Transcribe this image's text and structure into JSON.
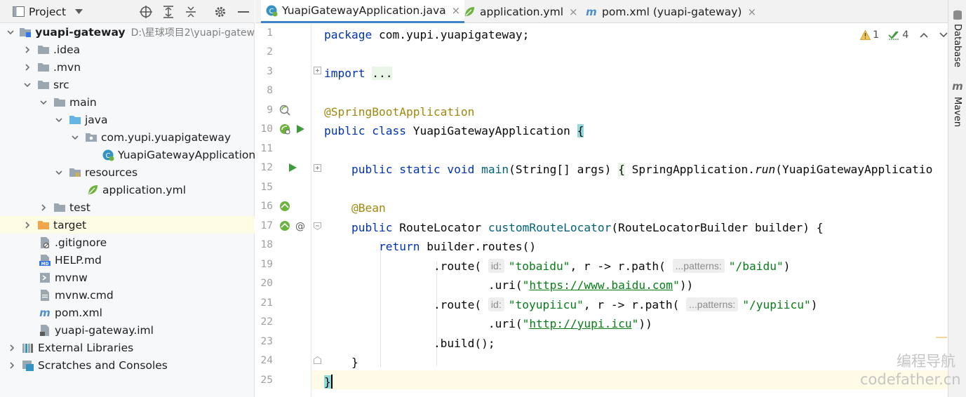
{
  "project_panel": {
    "title": "Project",
    "tree": [
      {
        "label": "yuapi-gateway",
        "path": "D:\\星球项目2\\yuapi-gatew",
        "icon": "module-folder-icon"
      },
      {
        "label": ".idea",
        "icon": "folder-icon"
      },
      {
        "label": ".mvn",
        "icon": "folder-icon"
      },
      {
        "label": "src",
        "icon": "folder-icon"
      },
      {
        "label": "main",
        "icon": "folder-icon"
      },
      {
        "label": "java",
        "icon": "source-folder-icon"
      },
      {
        "label": "com.yupi.yuapigateway",
        "icon": "package-icon"
      },
      {
        "label": "YuapiGatewayApplication",
        "icon": "spring-boot-class-icon"
      },
      {
        "label": "resources",
        "icon": "resources-folder-icon"
      },
      {
        "label": "application.yml",
        "icon": "spring-yml-icon"
      },
      {
        "label": "test",
        "icon": "folder-icon"
      },
      {
        "label": "target",
        "icon": "excluded-folder-icon"
      },
      {
        "label": ".gitignore",
        "icon": "ignore-file-icon"
      },
      {
        "label": "HELP.md",
        "icon": "markdown-icon"
      },
      {
        "label": "mvnw",
        "icon": "shell-file-icon"
      },
      {
        "label": "mvnw.cmd",
        "icon": "file-icon"
      },
      {
        "label": "pom.xml",
        "icon": "maven-icon"
      },
      {
        "label": "yuapi-gateway.iml",
        "icon": "iml-file-icon"
      },
      {
        "label": "External Libraries",
        "icon": "libraries-icon"
      },
      {
        "label": "Scratches and Consoles",
        "icon": "scratches-icon"
      }
    ]
  },
  "tabs": [
    {
      "label": "YuapiGatewayApplication.java",
      "close": "×"
    },
    {
      "label": "application.yml",
      "close": "×"
    },
    {
      "label": "pom.xml (yuapi-gateway)",
      "close": "×"
    }
  ],
  "inspections": {
    "warnings": "1",
    "weak_warnings": "4"
  },
  "line_numbers": [
    "1",
    "2",
    "3",
    "8",
    "9",
    "10",
    "11",
    "12",
    "15",
    "16",
    "17",
    "18",
    "19",
    "20",
    "21",
    "22",
    "23",
    "24",
    "25"
  ],
  "code": {
    "l1_kw": "package",
    "l1_rest": " com.yupi.yuapigateway;",
    "l3_kw": "import",
    "l3_fold": "...",
    "l9_ann": "@SpringBootApplication",
    "l10_kw": "public class",
    "l10_name": " YuapiGatewayApplication ",
    "l10_brace": "{",
    "l12_kw": "public static void",
    "l12_fn": "main",
    "l12_args": "(String[] args) ",
    "l12_brace": "{",
    "l12_call": " SpringApplication.",
    "l12_run": "run",
    "l12_tail": "(YuapiGatewayApplicatio",
    "l16_ann": "@Bean",
    "l17_kw": "public",
    "l17_type": " RouteLocator ",
    "l17_fn": "customRouteLocator",
    "l17_rest": "(RouteLocatorBuilder builder) {",
    "l18_kw": "return",
    "l18_rest": " builder.routes()",
    "l19_a": ".route(",
    "l19_hint_id": "id:",
    "l19_str": "\"tobaidu\"",
    "l19_b": ", r -> r.path(",
    "l19_hint_pat": "...patterns:",
    "l19_path": "\"/baidu\"",
    "l19_c": ")",
    "l20_a": ".uri(",
    "l20_q1": "\"",
    "l20_url": "https://www.baidu.com",
    "l20_q2": "\"",
    "l20_c": "))",
    "l21_a": ".route(",
    "l21_hint_id": "id:",
    "l21_str": "\"toyupiicu\"",
    "l21_b": ", r -> r.path(",
    "l21_hint_pat": "...patterns:",
    "l21_path": "\"/yupiicu\"",
    "l21_c": ")",
    "l22_a": ".uri(",
    "l22_q1": "\"",
    "l22_url": "http://yupi.icu",
    "l22_q2": "\"",
    "l22_c": "))",
    "l23": ".build();",
    "l24": "}",
    "l25": "}"
  },
  "right_strip": {
    "database": "Database",
    "maven": "Maven"
  },
  "watermark": {
    "line1": "编程导航",
    "line2": "codefather.cn"
  },
  "colors": {
    "accent": "#4083c9",
    "keyword": "#0033b3",
    "annotation": "#9e880d",
    "string": "#067d17",
    "function": "#00627a",
    "run_green": "#3d9a3d"
  }
}
